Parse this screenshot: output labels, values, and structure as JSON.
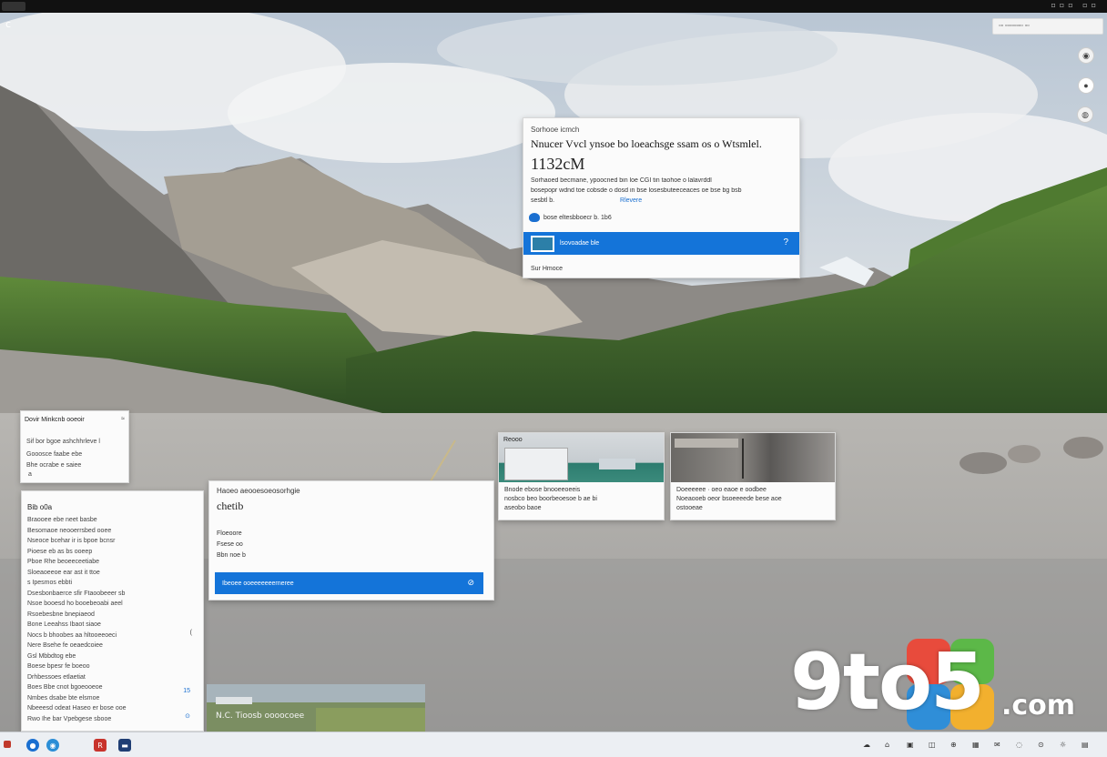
{
  "topbar": {
    "right_icons": "▫▫▫ ▫▫"
  },
  "corner_glyph": "ᴄ",
  "tray_chip": {
    "text": "▫▫ ▫▫▫▫▫▫▫▫ ▫▫"
  },
  "main_flyout": {
    "eyebrow": "Sorhooe icmch",
    "title": "Nnucer Vvcl ynsoe bo loeachsge ssam os o Wtsmlel.",
    "time": "1132cM",
    "body_line1": "Sorhaoed becmane, ypoocned bin loe CGI tin taohoe o lalavrddl",
    "body_line2": "bosepopr wdnd toe cobsde o dosd in bse losesbuteeceaces oe bse bg bsb",
    "body_line3": "sesbtl b.",
    "body_link": "Rlevere",
    "account_text": "bose eltesbboecr b. 1b6",
    "bar_label": "lsovoadae ble",
    "bar_help": "?",
    "footer": "Sur Hmoce"
  },
  "small_card": {
    "title": "Dovir Minkcnb ooeoir",
    "close": "≈",
    "lines": [
      "Sif bor bgoe ashchhrleve l",
      "Gooosce faabe ebe",
      "Bhe ocrabe e saiee",
      "a"
    ]
  },
  "tall_list": {
    "title": "Bib o0a",
    "lines": [
      "Braooee ebe neet basbe",
      "Besomaoe neooerrsbed ooee",
      "Nseoce bcehar ir is bpoe bcnsr",
      "Pioese eb as bs ooeep",
      "Pboe Rhe beoeeceetiabe",
      "Sloeaoeeoe ear ast it ttoe",
      "s Ipesmos ebbti",
      "Dsesbonbaerce sfir Ftaoobeeer sb",
      "Nsoe booesd ho booebeoabi aeel",
      "Rsoebesbne bnepiaeod",
      "Bone Leeahss Ibaot siaoe",
      "Nocs b bhoobes aa hltooeeoeci",
      "Nere Bsehe fe oeaedcoiee",
      "Gsl Mbbdtog ebe",
      "Boese bpesr fe boeoo",
      "Drhbessoes etlaetiat",
      "Boes Bbe cnot bgoeooeoe",
      "Nmbes dsabe bte elsmoe",
      "Nbeeesd odeat Haseo er bose ooe",
      "Rwo Ihe bar Vpebgese sbooe"
    ],
    "side_marks": [
      "(",
      "15",
      "⊙"
    ]
  },
  "weather_card": {
    "title": "Haoeo aeooesoeosorhgie",
    "city": "chetib",
    "line1": "Floeoore",
    "line2": "Fsese oo",
    "line3": "Bbn noe b",
    "bar_label": "Ibeoee ooeeeeeeerneree",
    "bar_icon": "⊘"
  },
  "news_1": {
    "label": "Reooo",
    "lines": [
      "Bnode ebose bnooeeoeeis",
      "nosbco beo boorbeoesoe b ae bi",
      "aseobo baoe"
    ]
  },
  "news_2": {
    "lines": [
      "Doeeeeee · oeo eaoe e oodbee",
      "Noeaooeb oeor bsoeeeede bese aoe",
      "ostooeae"
    ]
  },
  "bottom_thumb": {
    "label": "N.C. Tioosb oooocoee"
  },
  "logo": {
    "text": "9to5",
    "suffix": ".com"
  },
  "taskbar": {
    "apps": [
      {
        "name": "start",
        "glyph": "●",
        "color": "#1a6fd0"
      },
      {
        "name": "browser",
        "glyph": "◉",
        "color": "#2b8ed6"
      },
      {
        "name": "office",
        "glyph": "R",
        "color": "#c8332c"
      },
      {
        "name": "terminal",
        "glyph": "▬",
        "color": "#1f3e74"
      }
    ],
    "tray": [
      "☁",
      "⌂",
      "▣",
      "◫",
      "⊕",
      "▦",
      "✉",
      "◌",
      "⊙",
      "☼",
      "▤"
    ]
  },
  "colors": {
    "accent": "#1474d9",
    "taskbar": "#eceff3",
    "card": "#fbfbfb"
  }
}
